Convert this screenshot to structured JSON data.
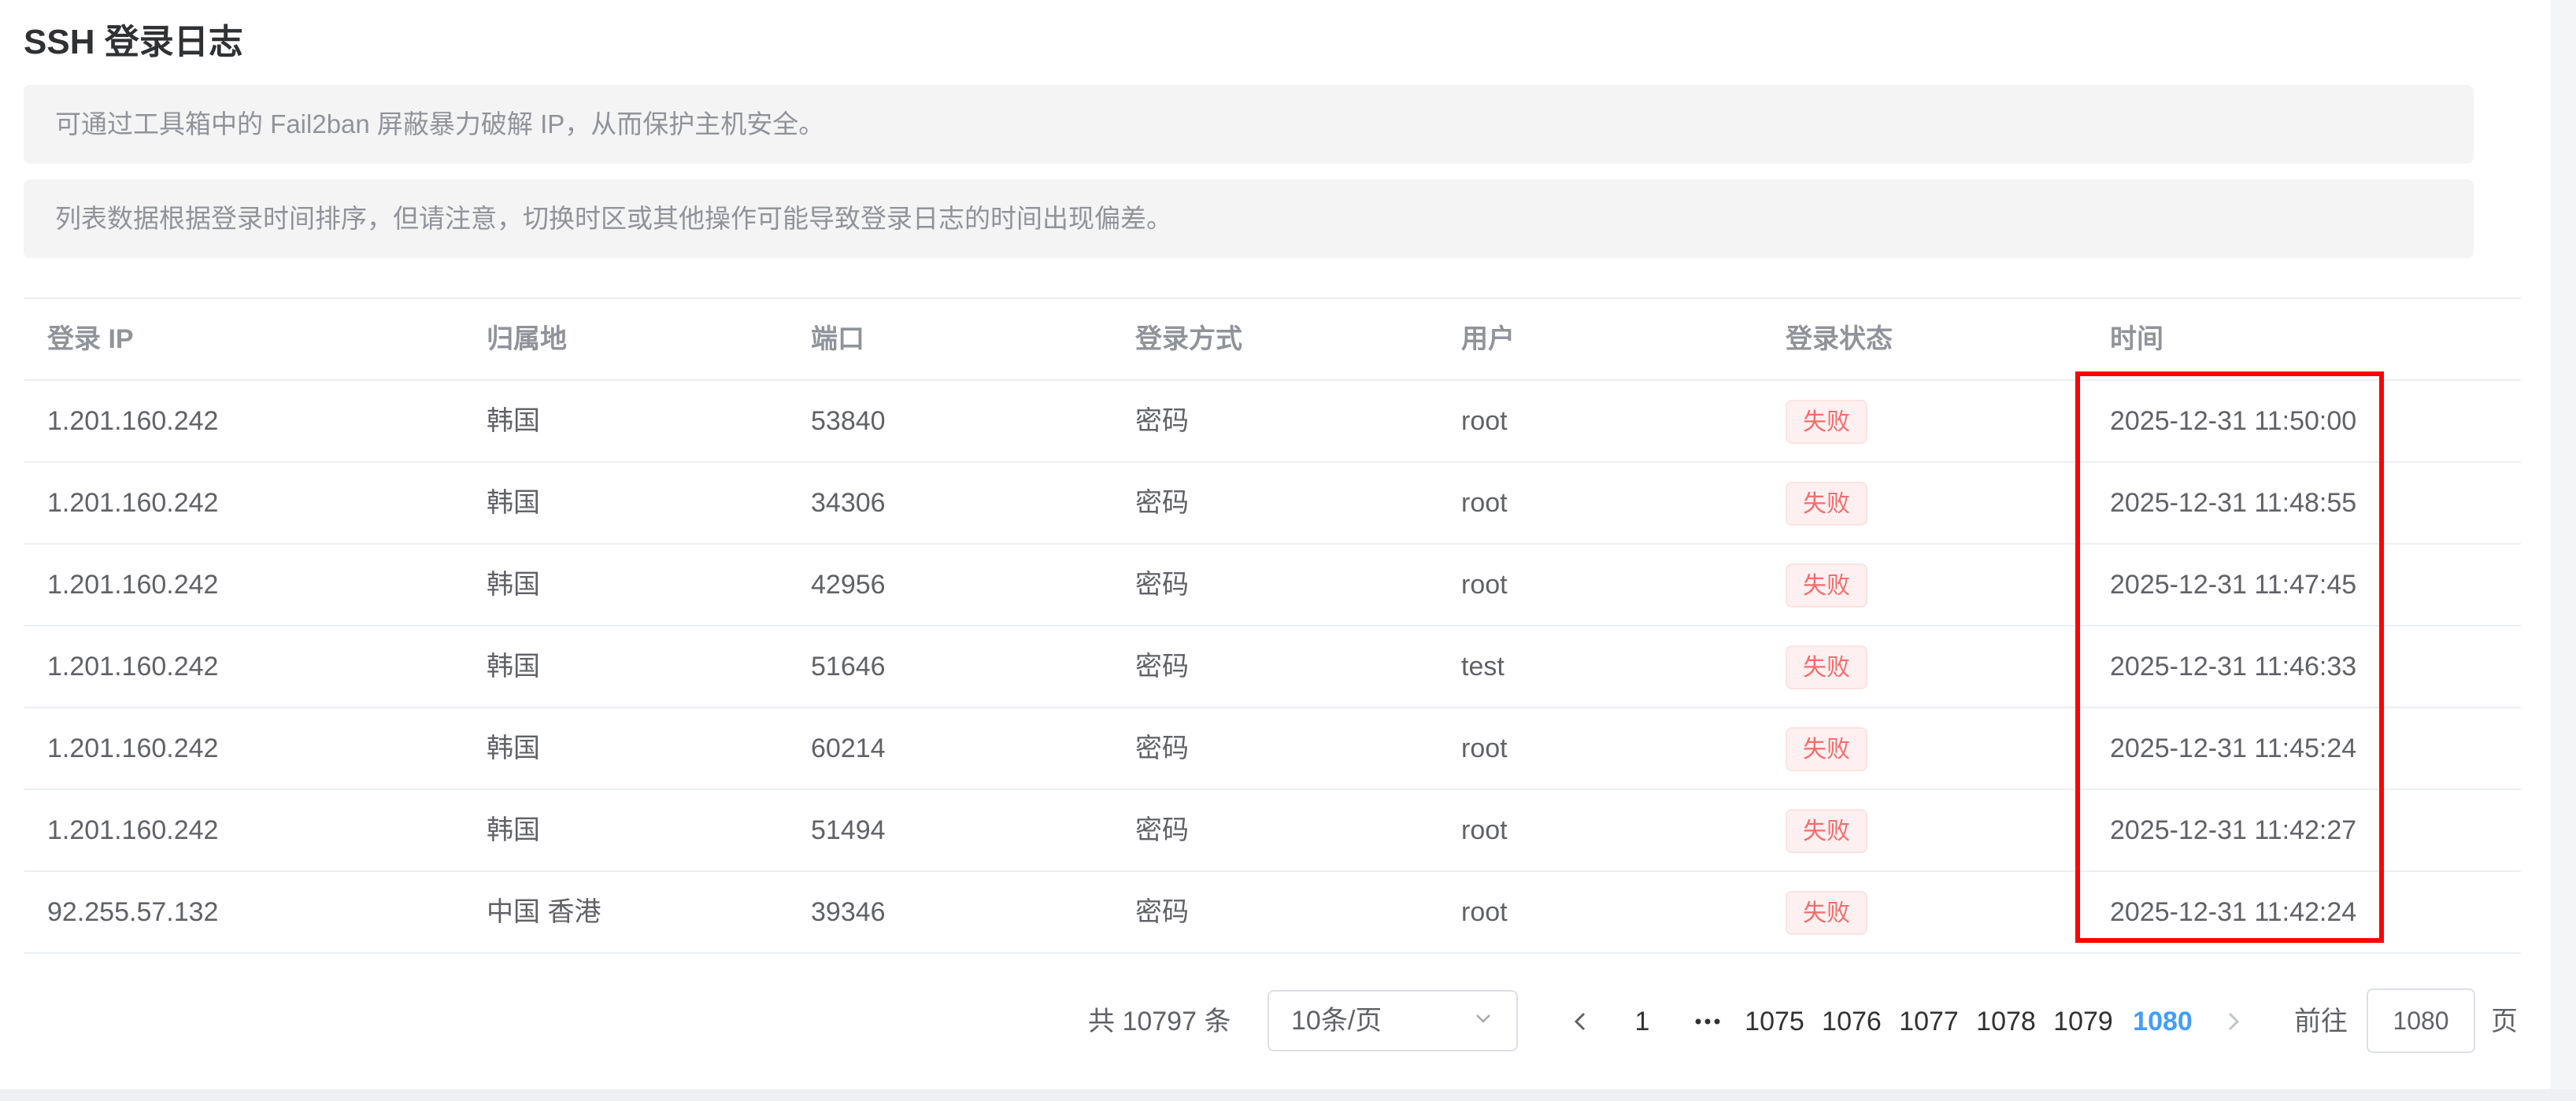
{
  "title": "SSH 登录日志",
  "alerts": [
    "可通过工具箱中的 Fail2ban 屏蔽暴力破解 IP，从而保护主机安全。",
    "列表数据根据登录时间排序，但请注意，切换时区或其他操作可能导致登录日志的时间出现偏差。"
  ],
  "table": {
    "headers": [
      "登录 IP",
      "归属地",
      "端口",
      "登录方式",
      "用户",
      "登录状态",
      "时间"
    ],
    "rows": [
      {
        "ip": "1.201.160.242",
        "location": "韩国",
        "port": "53840",
        "method": "密码",
        "user": "root",
        "status": "失败",
        "time": "2025-12-31 11:50:00"
      },
      {
        "ip": "1.201.160.242",
        "location": "韩国",
        "port": "34306",
        "method": "密码",
        "user": "root",
        "status": "失败",
        "time": "2025-12-31 11:48:55"
      },
      {
        "ip": "1.201.160.242",
        "location": "韩国",
        "port": "42956",
        "method": "密码",
        "user": "root",
        "status": "失败",
        "time": "2025-12-31 11:47:45"
      },
      {
        "ip": "1.201.160.242",
        "location": "韩国",
        "port": "51646",
        "method": "密码",
        "user": "test",
        "status": "失败",
        "time": "2025-12-31 11:46:33"
      },
      {
        "ip": "1.201.160.242",
        "location": "韩国",
        "port": "60214",
        "method": "密码",
        "user": "root",
        "status": "失败",
        "time": "2025-12-31 11:45:24"
      },
      {
        "ip": "1.201.160.242",
        "location": "韩国",
        "port": "51494",
        "method": "密码",
        "user": "root",
        "status": "失败",
        "time": "2025-12-31 11:42:27"
      },
      {
        "ip": "92.255.57.132",
        "location": "中国 香港",
        "port": "39346",
        "method": "密码",
        "user": "root",
        "status": "失败",
        "time": "2025-12-31 11:42:24"
      }
    ]
  },
  "pagination": {
    "total_label": "共 10797 条",
    "page_size": "10条/页",
    "pages": [
      "1",
      "1075",
      "1076",
      "1077",
      "1078",
      "1079",
      "1080"
    ],
    "current_page": "1080",
    "goto_label": "前往",
    "goto_value": "1080",
    "page_suffix": "页"
  },
  "colors": {
    "failed_tag_text": "#f56c6c",
    "failed_tag_bg": "#fef0f0",
    "active_page": "#409eff",
    "highlight_box": "#ff0000"
  },
  "icons": {
    "page_size_dropdown": "chevron-down-icon",
    "prev_page": "chevron-left-icon",
    "more_pages": "more-icon",
    "next_page": "chevron-right-icon"
  }
}
